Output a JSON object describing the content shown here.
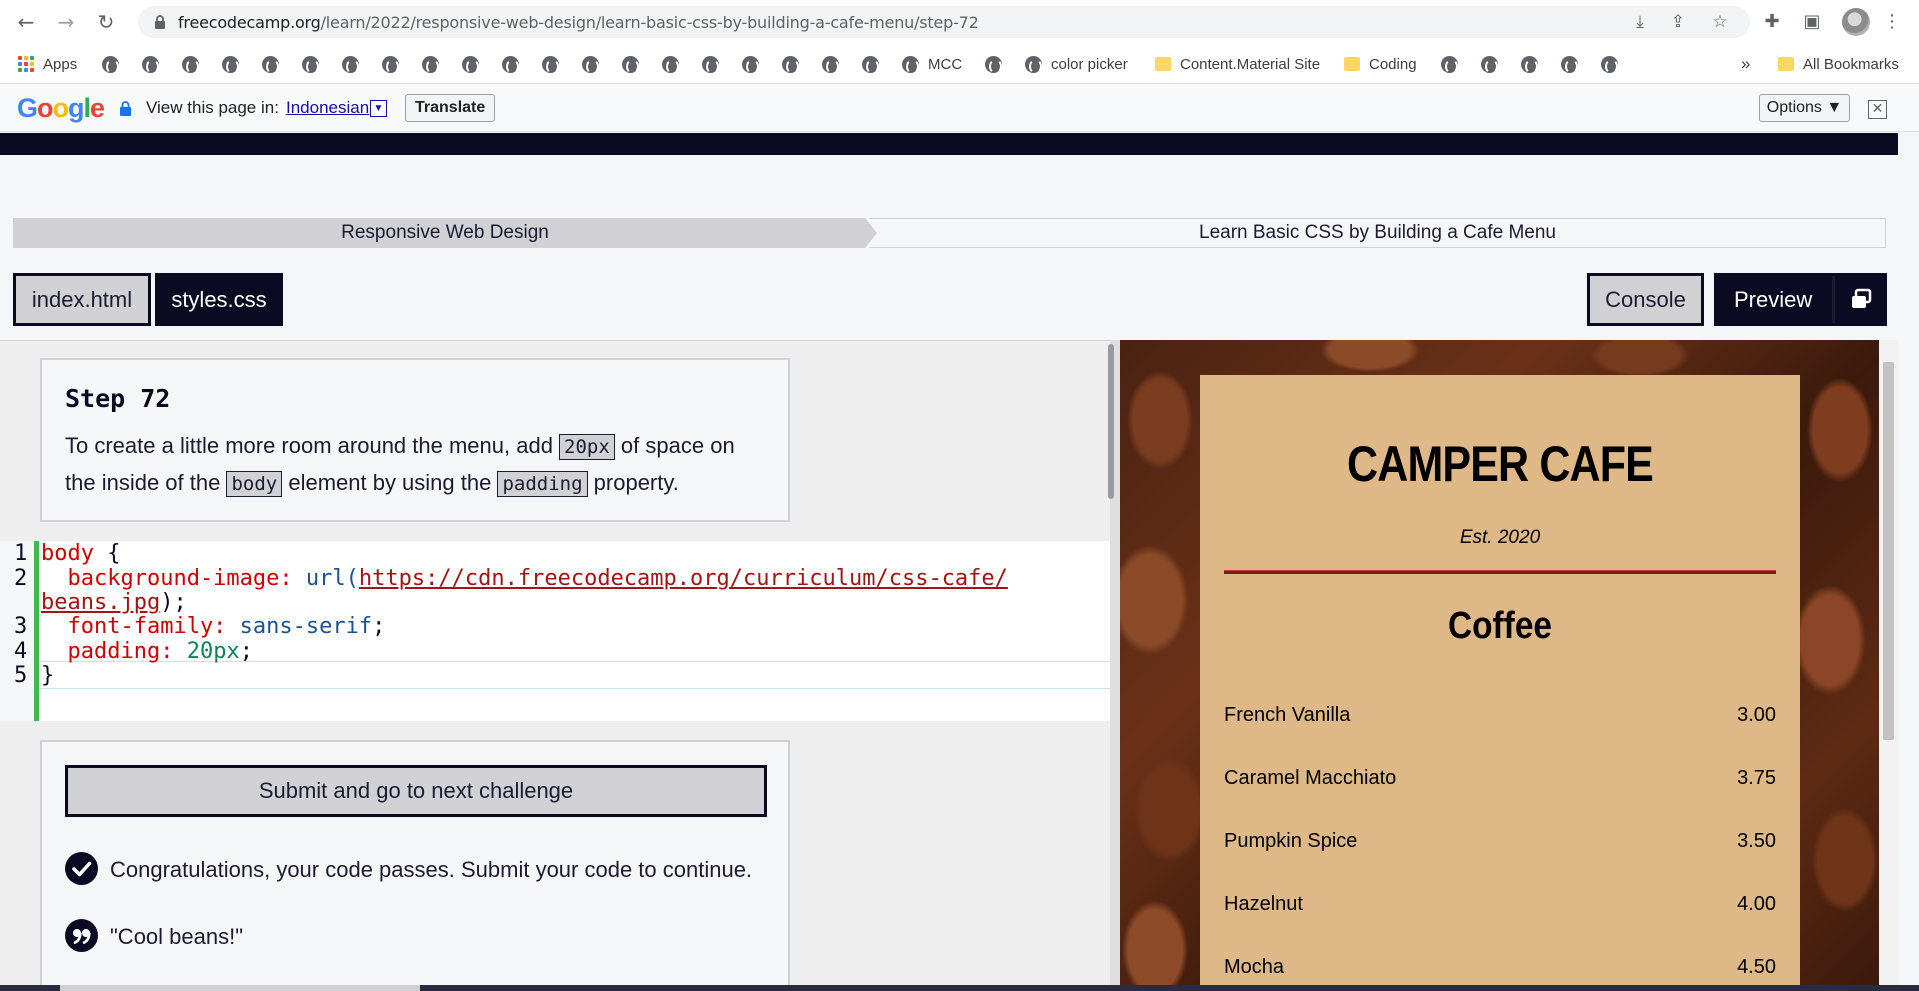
{
  "browser": {
    "url_host": "freecodecamp.org",
    "url_path": "/learn/2022/responsive-web-design/learn-basic-css-by-building-a-cafe-menu/step-72",
    "icons": [
      "back-icon",
      "forward-icon",
      "reload-icon",
      "lock-icon",
      "install-icon",
      "share-icon",
      "star-icon",
      "extensions-icon",
      "sidepanel-icon",
      "menu-icon"
    ]
  },
  "bookmarks": {
    "apps_label": "Apps",
    "mcc_label": "MCC",
    "color_picker_label": "color picker",
    "content_material_label": "Content.Material Site",
    "coding_label": "Coding",
    "overflow_label": "»",
    "all_bookmarks_label": "All Bookmarks"
  },
  "translate_bar": {
    "view_label": "View this page in:",
    "language": "Indonesian",
    "translate_button": "Translate",
    "options_button": "Options ▼"
  },
  "fcc": {
    "breadcrumb": [
      "Responsive Web Design",
      "Learn Basic CSS by Building a Cafe Menu"
    ],
    "tabs": [
      "index.html",
      "styles.css"
    ],
    "console_label": "Console",
    "preview_label": "Preview",
    "step_title": "Step 72",
    "step_text": {
      "part1": "To create a little more room around the menu, add ",
      "code1": "20px",
      "part2": " of space on the inside of the ",
      "code2": "body",
      "part3": " element by using the ",
      "code3": "padding",
      "part4": " property."
    },
    "code": {
      "line_numbers": [
        "1",
        "2",
        "3",
        "4",
        "5"
      ],
      "l1_selector": "body",
      "l1_brace": " {",
      "l2_prop": "  background-image:",
      "l2_fn": " url(",
      "l2_url_a": "https://cdn.freecodecamp.org/curriculum/css-cafe/",
      "l2_url_b": "beans.jpg",
      "l2_end": ");",
      "l3_prop": "  font-family:",
      "l3_val": " sans-serif",
      "l3_end": ";",
      "l4_prop": "  padding:",
      "l4_val": " 20px",
      "l4_end": ";",
      "l5": "}"
    },
    "submit_label": "Submit and go to next challenge",
    "pass_message": "Congratulations, your code passes. Submit your code to continue.",
    "quote": "\"Cool beans!\""
  },
  "preview": {
    "title": "CAMPER CAFE",
    "est": "Est. 2020",
    "section": "Coffee",
    "items": [
      {
        "name": "French Vanilla",
        "price": "3.00"
      },
      {
        "name": "Caramel Macchiato",
        "price": "3.75"
      },
      {
        "name": "Pumpkin Spice",
        "price": "3.50"
      },
      {
        "name": "Hazelnut",
        "price": "4.00"
      },
      {
        "name": "Mocha",
        "price": "4.50"
      }
    ]
  },
  "colors": {
    "fcc_dark": "#0a0a23",
    "fcc_gray": "#d0d0d5",
    "menu_bg": "#deb887",
    "hr_color": "#7c1d1d",
    "pass_green": "#3fb950"
  }
}
